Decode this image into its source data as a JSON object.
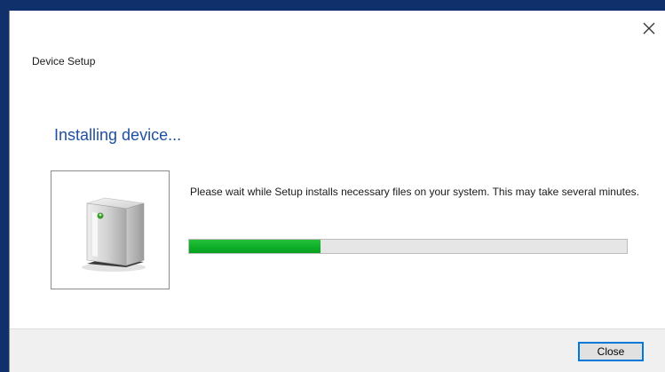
{
  "window": {
    "title": "Device Setup",
    "close_icon": "close-icon"
  },
  "main": {
    "heading": "Installing device...",
    "message": "Please wait while Setup installs necessary files on your system. This may take several minutes.",
    "device_icon": "device-icon",
    "progress": {
      "fraction": 0.3,
      "color": "#1db535"
    }
  },
  "footer": {
    "close_label": "Close"
  },
  "colors": {
    "heading": "#1f4fa3",
    "desktop": "#10306b",
    "focus": "#0078d7"
  }
}
